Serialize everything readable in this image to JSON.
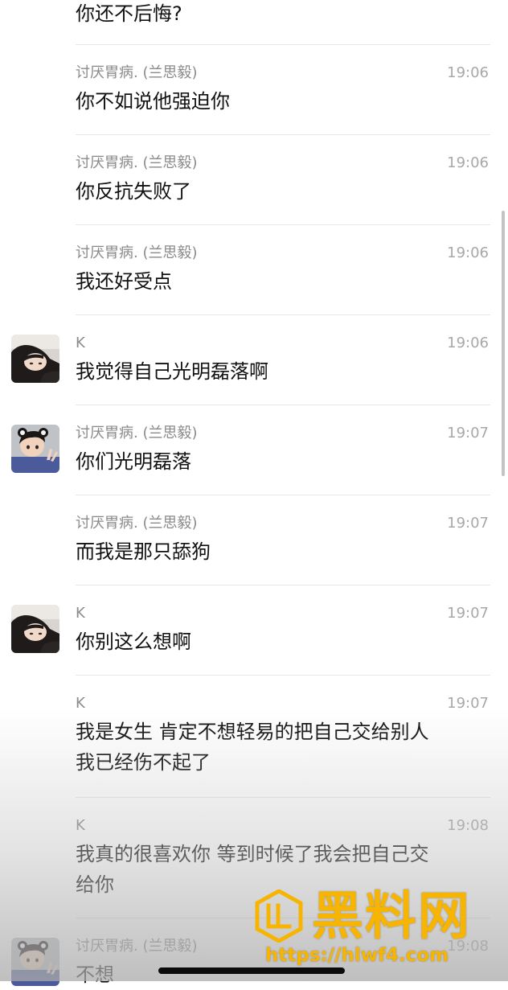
{
  "messages": [
    {
      "sender": "",
      "time": "",
      "text": "你还不后悔?",
      "avatar": "none"
    },
    {
      "sender": "讨厌胃病. (兰思毅)",
      "time": "19:06",
      "text": "你不如说他强迫你",
      "avatar": "none"
    },
    {
      "sender": "讨厌胃病. (兰思毅)",
      "time": "19:06",
      "text": "你反抗失败了",
      "avatar": "none"
    },
    {
      "sender": "讨厌胃病. (兰思毅)",
      "time": "19:06",
      "text": "我还好受点",
      "avatar": "none"
    },
    {
      "sender": "K",
      "time": "19:06",
      "text": "我觉得自己光明磊落啊",
      "avatar": "girl-avatar"
    },
    {
      "sender": "讨厌胃病. (兰思毅)",
      "time": "19:07",
      "text": "你们光明磊落",
      "avatar": "child-avatar"
    },
    {
      "sender": "讨厌胃病. (兰思毅)",
      "time": "19:07",
      "text": "而我是那只舔狗",
      "avatar": "none"
    },
    {
      "sender": "K",
      "time": "19:07",
      "text": "你别这么想啊",
      "avatar": "girl-avatar"
    },
    {
      "sender": "K",
      "time": "19:07",
      "text": "我是女生 肯定不想轻易的把自己交给别人\n我已经伤不起了",
      "avatar": "none"
    },
    {
      "sender": "K",
      "time": "19:08",
      "text": "我真的很喜欢你 等到时候了我会把自己交\n给你",
      "avatar": "none"
    },
    {
      "sender": "讨厌胃病. (兰思毅)",
      "time": "19:08",
      "text": "不想",
      "avatar": "child-avatar"
    }
  ],
  "watermark": {
    "title": "黑料网",
    "url": "https://hlwf4.com",
    "color": "#f7b400"
  },
  "colors": {
    "sender": "#8a8a8a",
    "time": "#a8a8a8",
    "text": "#111111",
    "divider": "#e6e6e6"
  }
}
